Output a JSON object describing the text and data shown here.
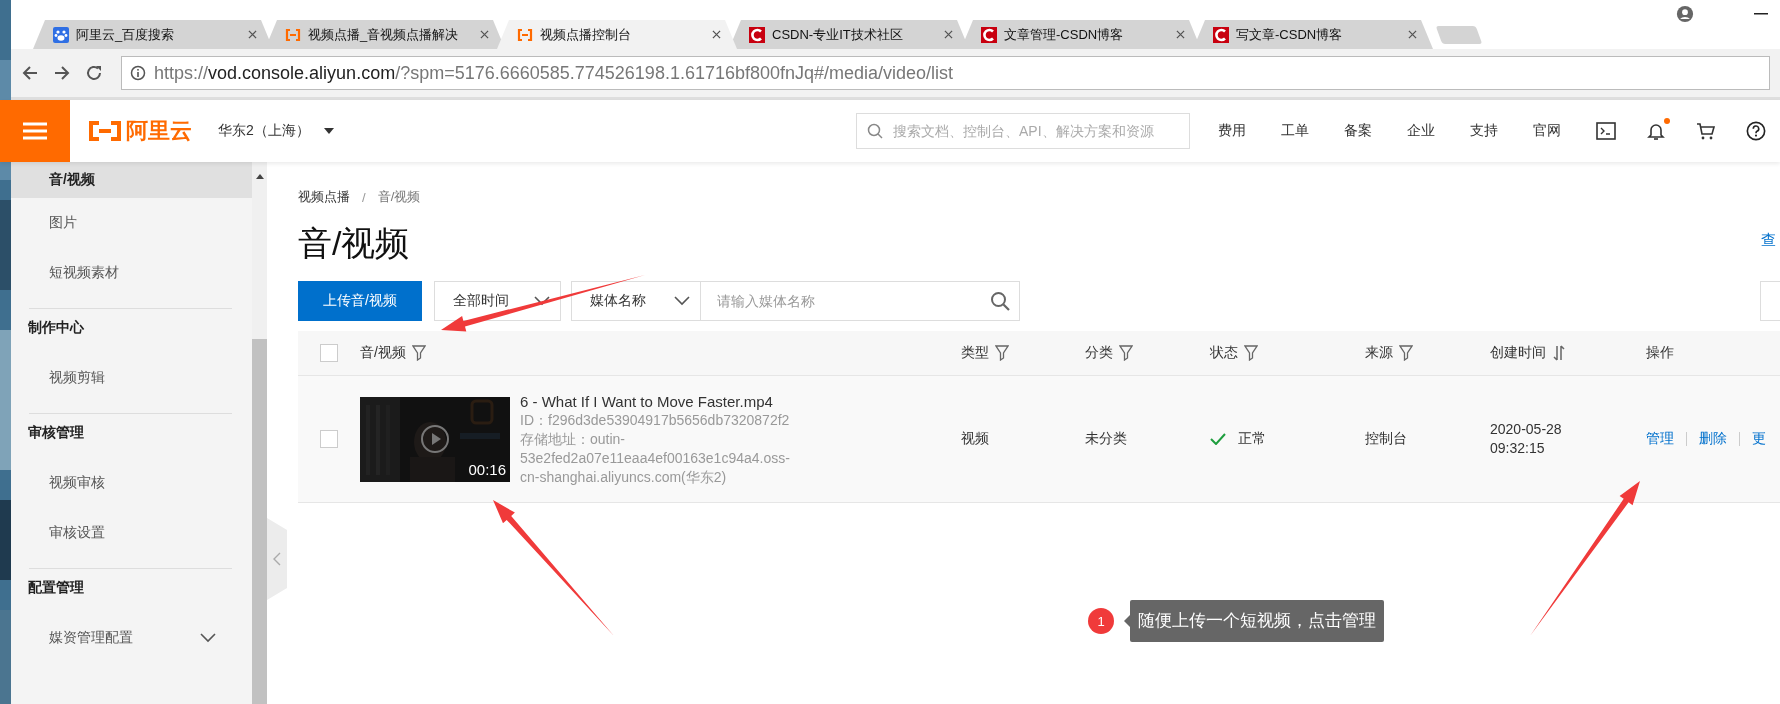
{
  "browser": {
    "tabs": [
      {
        "title": "阿里云_百度搜索",
        "kind": "paw",
        "selected": false
      },
      {
        "title": "视频点播_音视频点播解决",
        "kind": "bracket",
        "selected": false
      },
      {
        "title": "视频点播控制台",
        "kind": "bracket",
        "selected": true
      },
      {
        "title": "CSDN-专业IT技术社区",
        "kind": "c",
        "selected": false
      },
      {
        "title": "文章管理-CSDN博客",
        "kind": "c",
        "selected": false
      },
      {
        "title": "写文章-CSDN博客",
        "kind": "c",
        "selected": false
      }
    ],
    "url_scheme": "https://",
    "url_host": "vod.console.aliyun.com",
    "url_rest": "/?spm=5176.6660585.774526198.1.61716bf800fnJq#/media/video/list"
  },
  "header": {
    "logo_text": "阿里云",
    "region": "华东2（上海）",
    "search_placeholder": "搜索文档、控制台、API、解决方案和资源",
    "nav": [
      "费用",
      "工单",
      "备案",
      "企业",
      "支持",
      "官网"
    ],
    "notification_dot": true
  },
  "sidebar": {
    "sections": [
      {
        "items": [
          {
            "label": "音/视频",
            "selected": true
          },
          {
            "label": "图片",
            "selected": false
          },
          {
            "label": "短视频素材",
            "selected": false
          }
        ]
      },
      {
        "heading": "制作中心",
        "items": [
          {
            "label": "视频剪辑",
            "selected": false
          }
        ]
      },
      {
        "heading": "审核管理",
        "items": [
          {
            "label": "视频审核",
            "selected": false
          },
          {
            "label": "审核设置",
            "selected": false
          }
        ]
      },
      {
        "heading": "配置管理",
        "items": [
          {
            "label": "媒资管理配置",
            "selected": false,
            "expanded": false
          }
        ]
      }
    ]
  },
  "page": {
    "breadcrumb": [
      "视频点播",
      "音/视频"
    ],
    "breadcrumb_separator": "/",
    "title": "音/视频",
    "corner_link": "查",
    "upload_button": "上传音/视频",
    "time_filter": "全部时间",
    "media_filter": "媒体名称",
    "search_placeholder": "请输入媒体名称",
    "table": {
      "all_checked": false,
      "columns": [
        {
          "label": "音/视频",
          "kind": "filter"
        },
        {
          "label": "类型",
          "kind": "filter"
        },
        {
          "label": "分类",
          "kind": "filter"
        },
        {
          "label": "状态",
          "kind": "filter"
        },
        {
          "label": "来源",
          "kind": "filter"
        },
        {
          "label": "创建时间",
          "kind": "sort"
        },
        {
          "label": "操作",
          "kind": "plain"
        }
      ],
      "rows": [
        {
          "checked": false,
          "duration": "00:16",
          "name": "6 - What If I Want to Move Faster.mp4",
          "id": "ID：f296d3de53904917b5656db7320872f2",
          "storage": "存储地址：outin-53e2fed2a07e11eaa4ef00163e1c94a4.oss-cn-shanghai.aliyuncs.com(华东2)",
          "type": "视频",
          "category": "未分类",
          "status": "正常",
          "status_ok": true,
          "source": "控制台",
          "created_date": "2020-05-28",
          "created_time": "09:32:15",
          "actions": [
            "管理",
            "删除",
            "更"
          ]
        }
      ]
    }
  },
  "annotation": {
    "step": "1",
    "text": "随便上传一个短视频，点击管理"
  }
}
